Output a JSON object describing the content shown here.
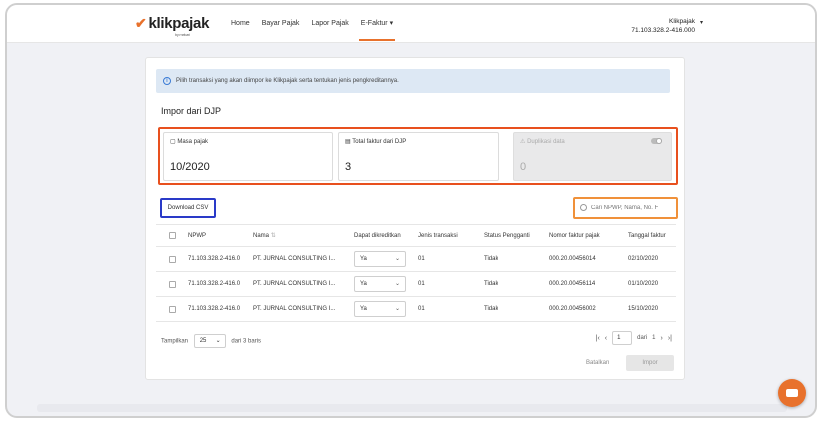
{
  "header": {
    "logo": "klikpajak",
    "logo_tagline": "by mekari",
    "nav": [
      {
        "label": "Home"
      },
      {
        "label": "Bayar Pajak"
      },
      {
        "label": "Lapor Pajak"
      },
      {
        "label": "E-Faktur"
      }
    ],
    "user_name": "Klikpajak",
    "user_npwp": "71.103.328.2-416.000"
  },
  "info_text": "Pilih transaksi yang akan diimpor ke Klikpajak serta tentukan jenis pengkreditannya.",
  "page_title": "Impor dari DJP",
  "summary": {
    "masa_pajak_label": "Masa pajak",
    "masa_pajak_value": "10/2020",
    "total_label": "Total faktur dari DJP",
    "total_value": "3",
    "duplikasi_label": "Duplikasi data",
    "duplikasi_value": "0"
  },
  "download_label": "Download CSV",
  "search_placeholder": "Cari NPWP, Nama, No. F",
  "table": {
    "headers": [
      "NPWP",
      "Nama",
      "Dapat dikreditkan",
      "Jenis transaksi",
      "Status Pengganti",
      "Nomor faktur pajak",
      "Tanggal faktur"
    ],
    "rows": [
      {
        "npwp": "71.103.328.2-416.0",
        "nama": "PT. JURNAL CONSULTING I...",
        "kredit": "Ya",
        "jenis": "01",
        "status": "Tidak",
        "nomor": "000.20.00456014",
        "tanggal": "02/10/2020"
      },
      {
        "npwp": "71.103.328.2-416.0",
        "nama": "PT. JURNAL CONSULTING I...",
        "kredit": "Ya",
        "jenis": "01",
        "status": "Tidak",
        "nomor": "000.20.00456114",
        "tanggal": "01/10/2020"
      },
      {
        "npwp": "71.103.328.2-416.0",
        "nama": "PT. JURNAL CONSULTING I...",
        "kredit": "Ya",
        "jenis": "01",
        "status": "Tidak",
        "nomor": "000.20.00456002",
        "tanggal": "15/10/2020"
      }
    ]
  },
  "footer": {
    "show_label": "Tampilkan",
    "per_page": "25",
    "of_rows": "dari 3 baris",
    "page": "1",
    "of_pages_prefix": "dari",
    "total_pages": "1"
  },
  "actions": {
    "cancel": "Batalkan",
    "import": "Impor"
  },
  "colors": {
    "brand": "#e8712c",
    "summary_highlight": "#e8501e",
    "download_highlight": "#2a3ac8",
    "search_highlight": "#f0913a",
    "info_bg": "#dde8f4"
  }
}
